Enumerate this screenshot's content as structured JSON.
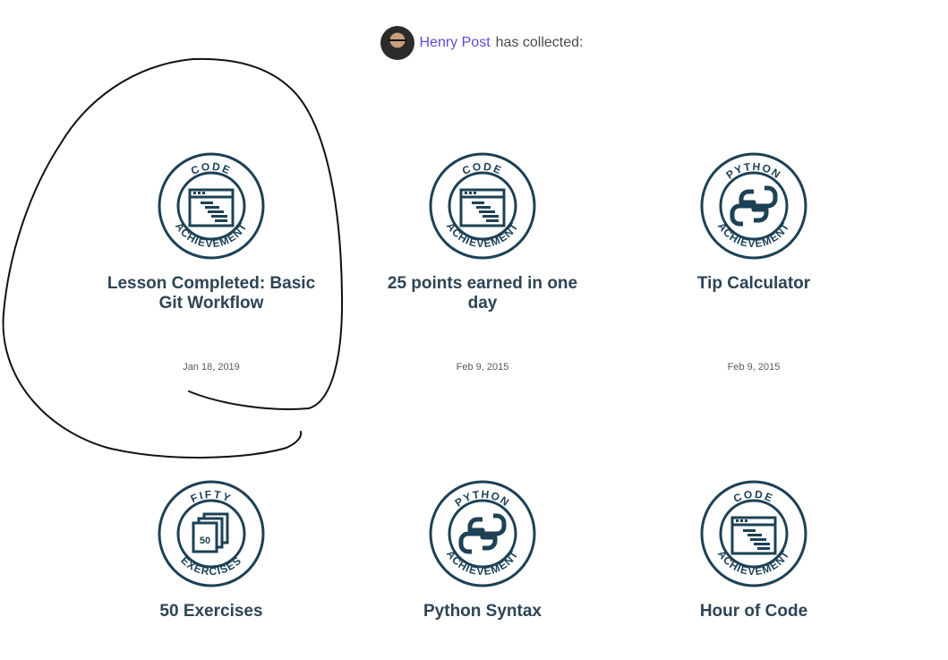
{
  "profile": {
    "name": "Henry Post",
    "suffix": "has collected:"
  },
  "badges": [
    {
      "type": "code",
      "ring_top": "CODE",
      "ring_bottom": "ACHIEVEMENT",
      "title": "Lesson Completed: Basic Git Workflow",
      "date": "Jan 18, 2019"
    },
    {
      "type": "code",
      "ring_top": "CODE",
      "ring_bottom": "ACHIEVEMENT",
      "title": "25 points earned in one day",
      "date": "Feb 9, 2015"
    },
    {
      "type": "python",
      "ring_top": "PYTHON",
      "ring_bottom": "ACHIEVEMENT",
      "title": "Tip Calculator",
      "date": "Feb 9, 2015"
    },
    {
      "type": "fifty",
      "ring_top": "FIFTY",
      "ring_bottom": "EXERCISES",
      "badge_number": "50",
      "title": "50 Exercises",
      "date": ""
    },
    {
      "type": "python",
      "ring_top": "PYTHON",
      "ring_bottom": "ACHIEVEMENT",
      "title": "Python Syntax",
      "date": ""
    },
    {
      "type": "code",
      "ring_top": "CODE",
      "ring_bottom": "ACHIEVEMENT",
      "title": "Hour of Code",
      "date": ""
    }
  ],
  "colors": {
    "badge": "#1d4155",
    "link": "#5b4bd6",
    "annotation": "#111111"
  },
  "icons": [
    "avatar-image",
    "code-window-icon",
    "python-logo-icon",
    "stacked-pages-icon"
  ]
}
